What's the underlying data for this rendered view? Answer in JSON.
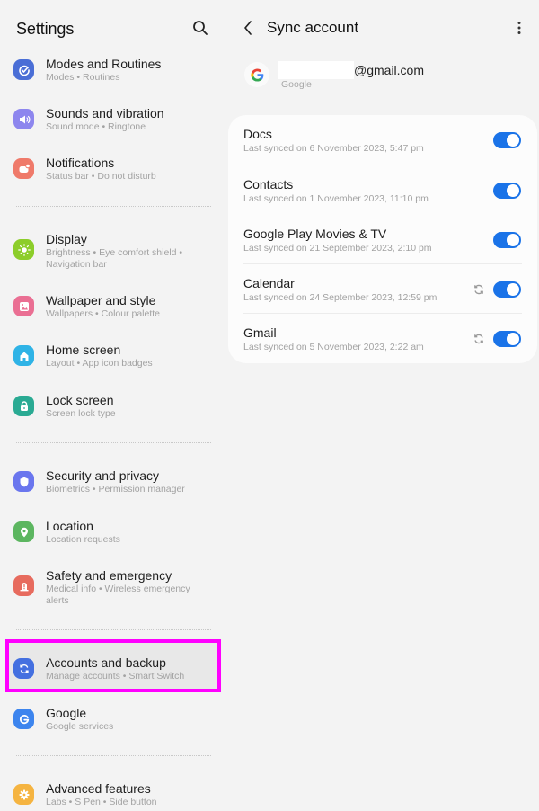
{
  "colors": {
    "accent": "#1a73e8",
    "highlight": "#ff00ff",
    "background": "#f3f3f3",
    "card": "#fcfcfc"
  },
  "settings_pane": {
    "title": "Settings",
    "search_icon": "search-icon",
    "groups": [
      {
        "items": [
          {
            "label": "Modes and Routines",
            "sub": "Modes  •  Routines",
            "icon": "modes-routines-icon",
            "icon_color": "#4a6ed6"
          },
          {
            "label": "Sounds and vibration",
            "sub": "Sound mode  •  Ringtone",
            "icon": "speaker-icon",
            "icon_color": "#8d86ee"
          },
          {
            "label": "Notifications",
            "sub": "Status bar  •  Do not disturb",
            "icon": "notification-icon",
            "icon_color": "#ef7a6a"
          }
        ]
      },
      {
        "items": [
          {
            "label": "Display",
            "sub": "Brightness  •  Eye comfort shield  •  Navigation bar",
            "icon": "sun-icon",
            "icon_color": "#8ccd2a"
          },
          {
            "label": "Wallpaper and style",
            "sub": "Wallpapers  •  Colour palette",
            "icon": "wallpaper-icon",
            "icon_color": "#ea6f93"
          },
          {
            "label": "Home screen",
            "sub": "Layout  •  App icon badges",
            "icon": "home-icon",
            "icon_color": "#2fb3e6"
          },
          {
            "label": "Lock screen",
            "sub": "Screen lock type",
            "icon": "lock-icon",
            "icon_color": "#2aaa93"
          }
        ]
      },
      {
        "items": [
          {
            "label": "Security and privacy",
            "sub": "Biometrics  •  Permission manager",
            "icon": "shield-icon",
            "icon_color": "#6a76ee"
          },
          {
            "label": "Location",
            "sub": "Location requests",
            "icon": "location-pin-icon",
            "icon_color": "#5cb660"
          },
          {
            "label": "Safety and emergency",
            "sub": "Medical info  •  Wireless emergency alerts",
            "icon": "emergency-icon",
            "icon_color": "#e76b5e"
          }
        ]
      },
      {
        "items": [
          {
            "label": "Accounts and backup",
            "sub": "Manage accounts  •  Smart Switch",
            "icon": "sync-accounts-icon",
            "icon_color": "#4470e0",
            "selected": true
          },
          {
            "label": "Google",
            "sub": "Google services",
            "icon": "google-g-icon",
            "icon_color": "#3d85ee"
          }
        ]
      },
      {
        "items": [
          {
            "label": "Advanced features",
            "sub": "Labs  •  S Pen  •  Side button",
            "icon": "gear-icon",
            "icon_color": "#f5b441"
          }
        ]
      }
    ]
  },
  "sync_pane": {
    "title": "Sync account",
    "back_icon": "back-chevron-icon",
    "more_icon": "more-vertical-icon",
    "account": {
      "email_visible": "@gmail.com",
      "type": "Google"
    },
    "items": [
      {
        "name": "Docs",
        "last_synced": "Last synced on 6 November 2023, 5:47 pm",
        "enabled": true,
        "sync_icon": false
      },
      {
        "name": "Contacts",
        "last_synced": "Last synced on 1 November 2023, 11:10 pm",
        "enabled": true,
        "sync_icon": false,
        "highlighted": true
      },
      {
        "name": "Google Play Movies & TV",
        "last_synced": "Last synced on 21 September 2023, 2:10 pm",
        "enabled": true,
        "sync_icon": false
      },
      {
        "name": "Calendar",
        "last_synced": "Last synced on 24 September 2023, 12:59 pm",
        "enabled": true,
        "sync_icon": true
      },
      {
        "name": "Gmail",
        "last_synced": "Last synced on 5 November 2023, 2:22 am",
        "enabled": true,
        "sync_icon": true
      }
    ]
  }
}
